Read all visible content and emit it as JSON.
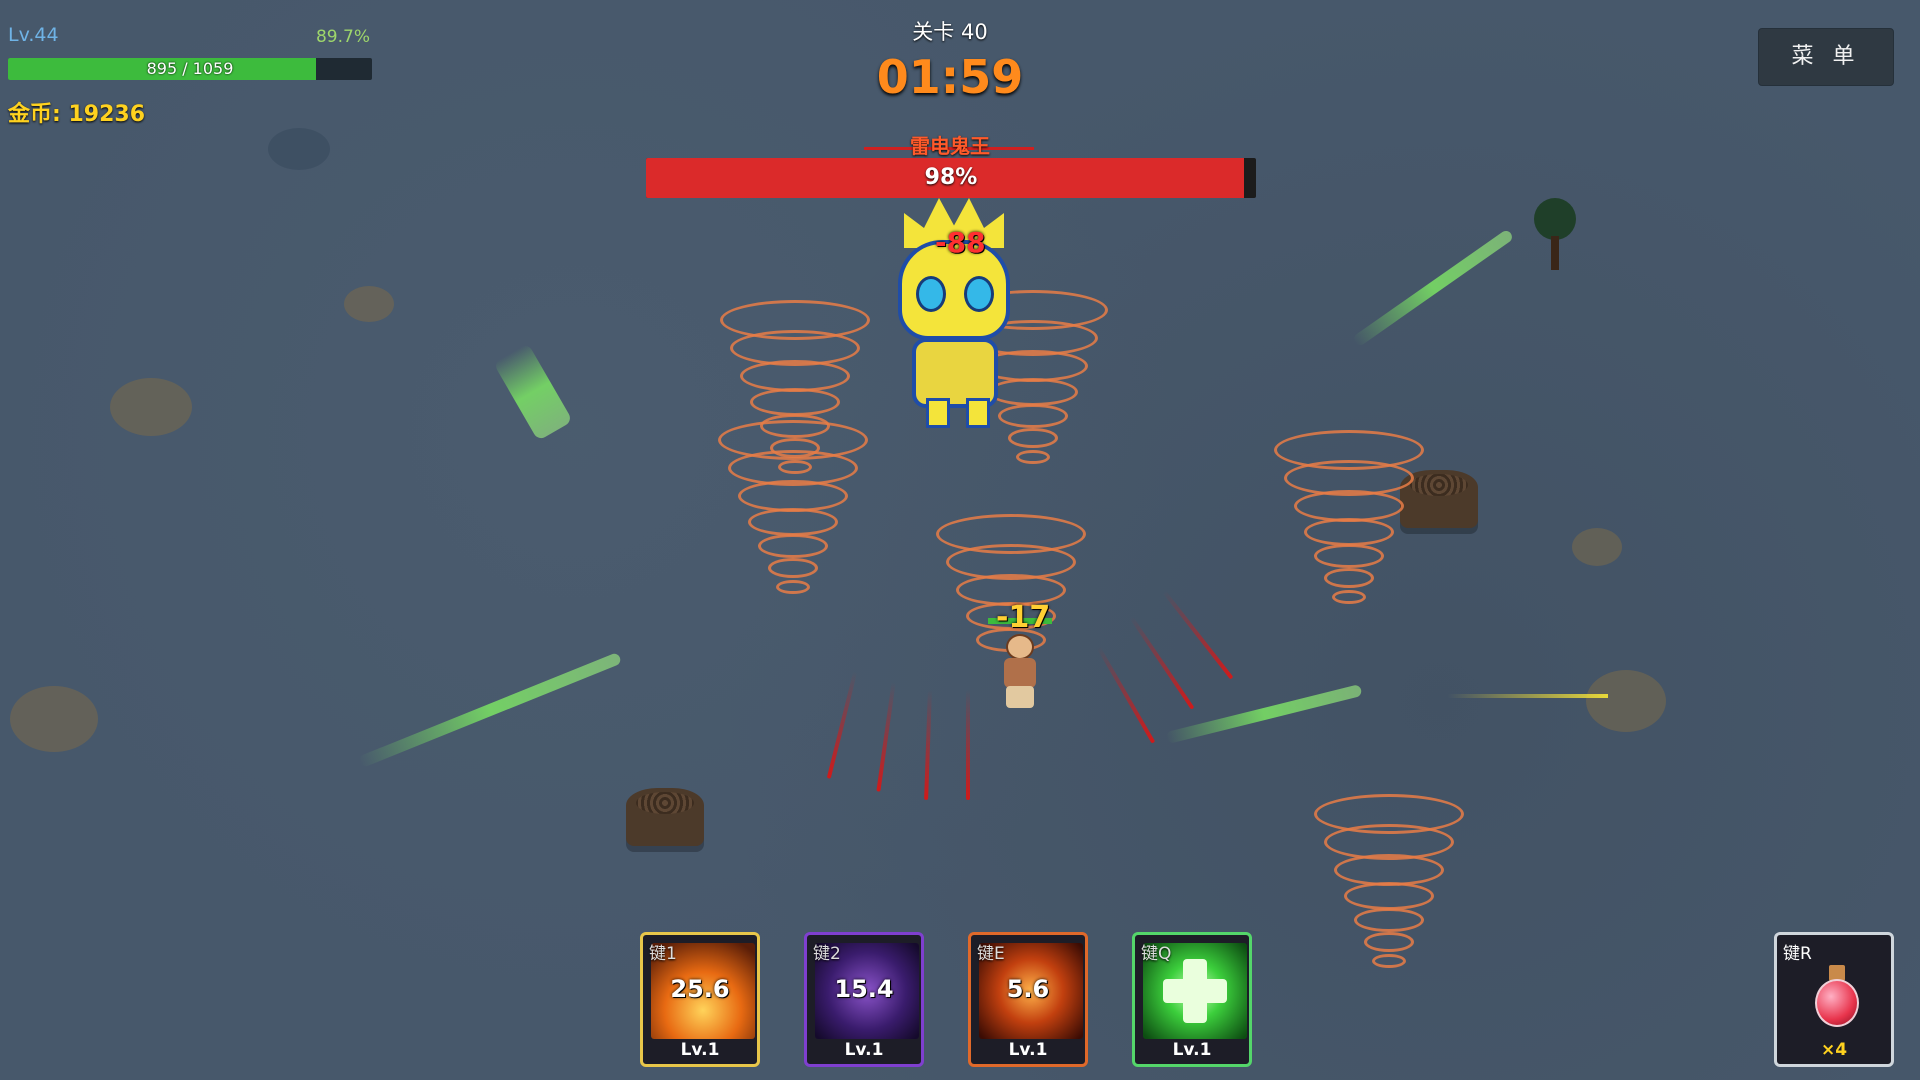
{
  "player": {
    "level": "Lv.44",
    "exp_percent": "89.7%",
    "hp_text": "895 / 1059",
    "hp_current": 895,
    "hp_max": 1059,
    "gold_text": "金币: 19236"
  },
  "stage": {
    "label": "关卡 40",
    "timer": "01:59"
  },
  "boss": {
    "name": "雷电鬼王",
    "hp_percent_text": "98%",
    "hp_fraction": 0.98
  },
  "menu": {
    "label": "菜 单"
  },
  "damage": {
    "boss_hit": "-88",
    "player_hit": "-17"
  },
  "skills": [
    {
      "key": "键1",
      "cooldown": "25.6",
      "level": "Lv.1",
      "icon": "fire-slash-icon"
    },
    {
      "key": "键2",
      "cooldown": "15.4",
      "level": "Lv.1",
      "icon": "void-vortex-icon"
    },
    {
      "key": "键E",
      "cooldown": "5.6",
      "level": "Lv.1",
      "icon": "flame-burst-icon"
    },
    {
      "key": "键Q",
      "cooldown": "",
      "level": "Lv.1",
      "icon": "heal-cross-icon"
    }
  ],
  "potion": {
    "key": "键R",
    "count": "×4",
    "icon": "health-potion-icon"
  },
  "colors": {
    "hp_green": "#3dbb3d",
    "boss_red": "#db2a2a",
    "gold": "#ffd21f",
    "timer_orange": "#ff8a1c"
  }
}
